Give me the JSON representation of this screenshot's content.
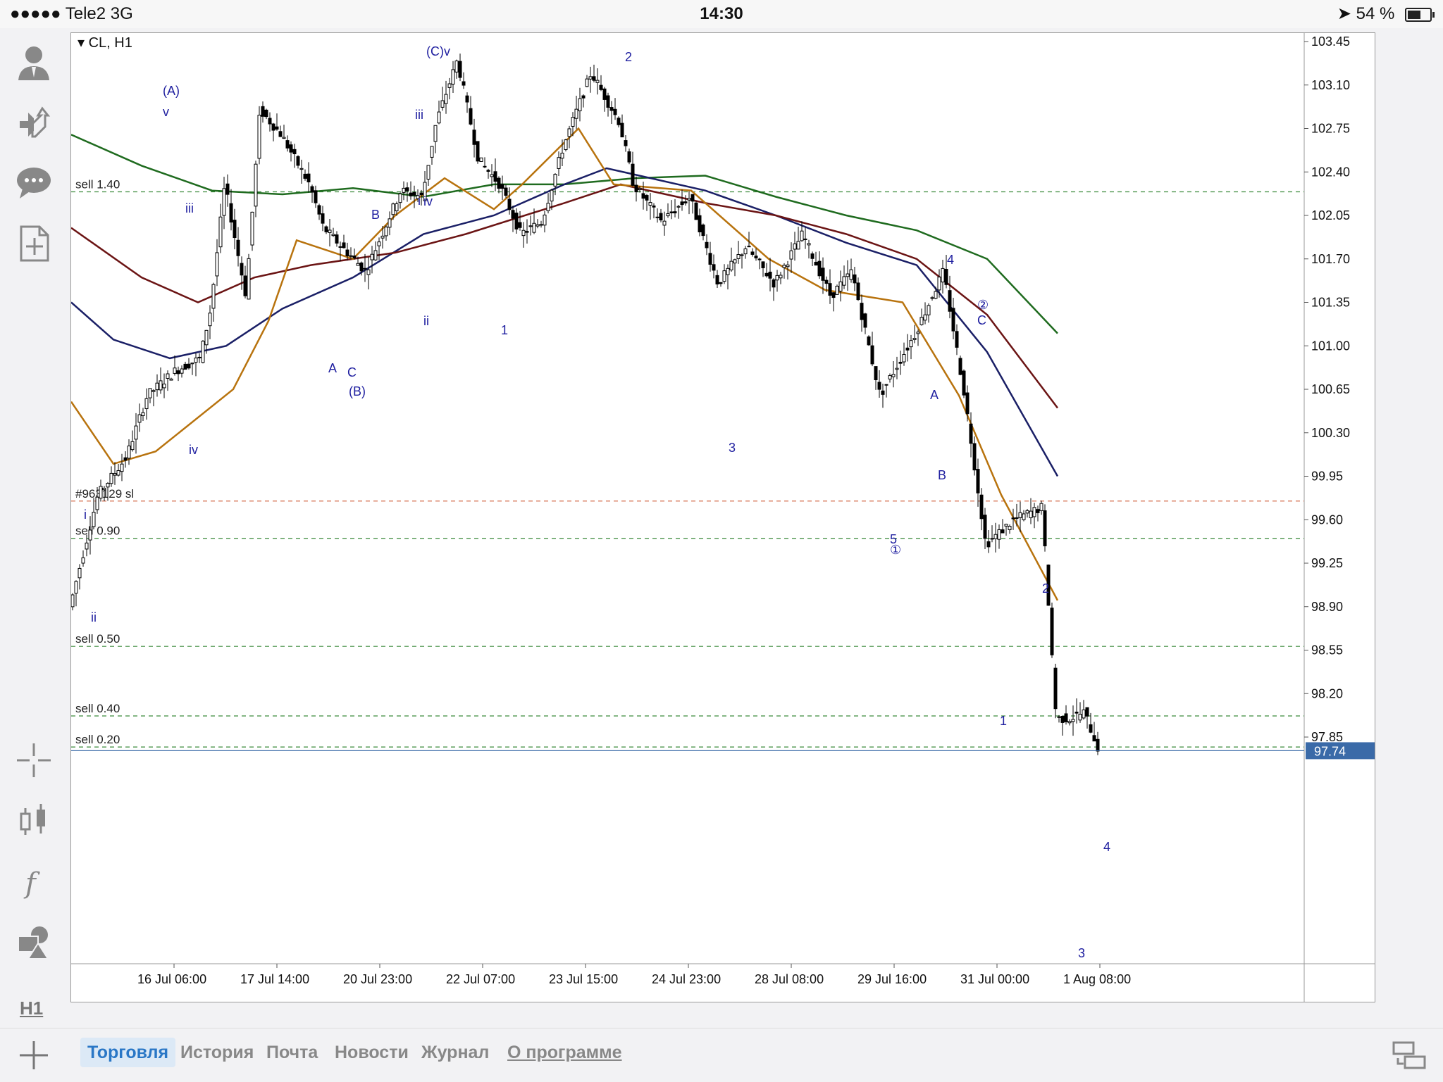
{
  "status_bar": {
    "signal": "●●●●● Tele2   3G",
    "time": "14:30",
    "battery": "54 %"
  },
  "chart": {
    "symbol": "CL, H1",
    "price_scale": [
      "103.45",
      "103.10",
      "102.75",
      "102.40",
      "102.05",
      "101.70",
      "101.35",
      "101.00",
      "100.65",
      "100.30",
      "99.95",
      "99.60",
      "99.25",
      "98.90",
      "98.55",
      "98.20",
      "97.85"
    ],
    "time_scale": [
      "16 Jul 06:00",
      "17 Jul 14:00",
      "20 Jul 23:00",
      "22 Jul 07:00",
      "23 Jul 15:00",
      "24 Jul 23:00",
      "28 Jul 08:00",
      "29 Jul 16:00",
      "31 Jul 00:00",
      "1 Aug 08:00"
    ],
    "current_price": "97.74",
    "order_lines": [
      {
        "label": "sell 1.40",
        "price": 102.24
      },
      {
        "label": "#963129 sl",
        "price": 99.75
      },
      {
        "label": "sell 0.90",
        "price": 99.45
      },
      {
        "label": "sell 0.50",
        "price": 98.58
      },
      {
        "label": "sell 0.40",
        "price": 98.02
      },
      {
        "label": "sell 0.20",
        "price": 97.77
      }
    ],
    "wave_labels": [
      "(A)",
      "v",
      "iii",
      "iv",
      "ii",
      "i",
      "B",
      "A",
      "C",
      "(B)",
      "iii",
      "i",
      "iv",
      "ii",
      "(C)v",
      "1",
      "2",
      "3",
      "4",
      "5",
      "①",
      "A",
      "B",
      "C",
      "②",
      "1",
      "2",
      "3",
      "4"
    ],
    "colors": {
      "ma_green": "#1f6b1f",
      "ma_navy": "#1a1f66",
      "ma_brown": "#6b1414",
      "ma_orange": "#b8730e",
      "candle": "#000000",
      "wave_text": "#2020a0",
      "order_green": "#3a8a3a",
      "sl_red": "#d46a4a",
      "price_tag": "#3a6aa8"
    }
  },
  "sidebar": {
    "h1_label": "H1",
    "icons": [
      "account-icon",
      "trade-icon",
      "chat-icon",
      "add-document-icon",
      "crosshair-icon",
      "chart-type-icon",
      "indicator-icon",
      "objects-icon"
    ]
  },
  "bottom_nav": {
    "tabs": [
      "Торговля",
      "История",
      "Почта",
      "Новости",
      "Журнал",
      "О программе"
    ]
  }
}
